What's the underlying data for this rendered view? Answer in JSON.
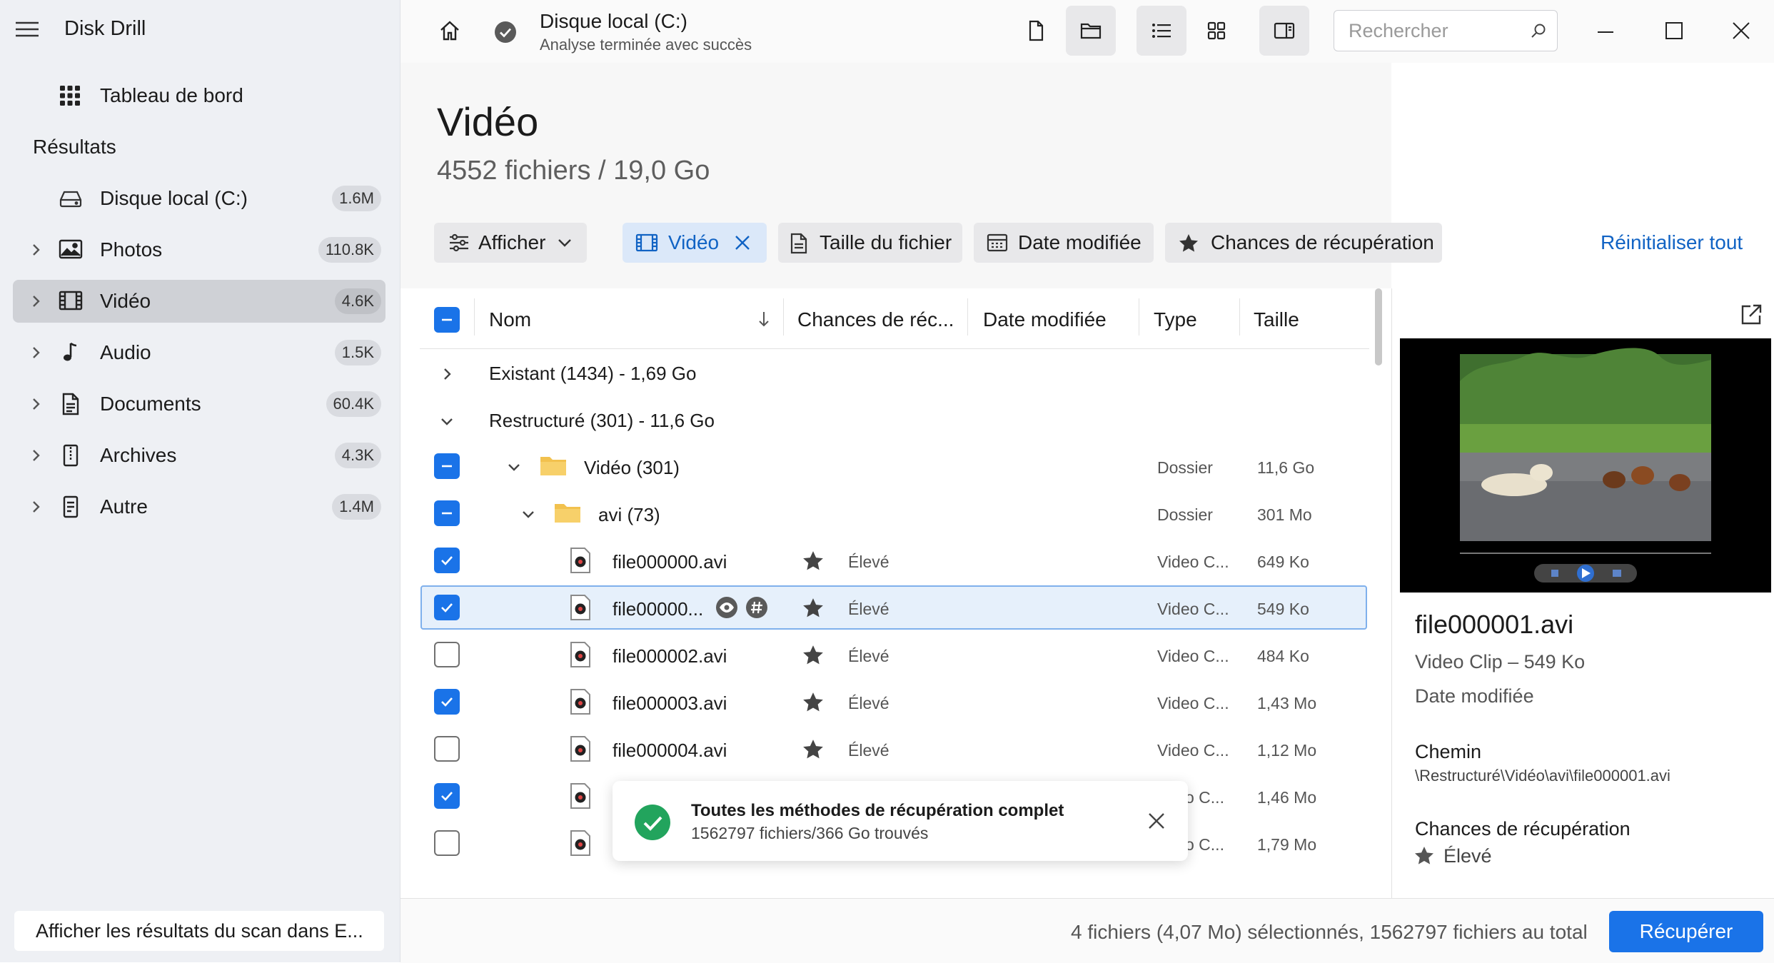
{
  "app": {
    "title": "Disk Drill"
  },
  "sidebar": {
    "dashboard_label": "Tableau de bord",
    "results_heading": "Résultats",
    "items": [
      {
        "label": "Disque local (C:)",
        "count": "1.6M"
      },
      {
        "label": "Photos",
        "count": "110.8K"
      },
      {
        "label": "Vidéo",
        "count": "4.6K"
      },
      {
        "label": "Audio",
        "count": "1.5K"
      },
      {
        "label": "Documents",
        "count": "60.4K"
      },
      {
        "label": "Archives",
        "count": "4.3K"
      },
      {
        "label": "Autre",
        "count": "1.4M"
      }
    ],
    "explorer_button": "Afficher les résultats du scan dans E..."
  },
  "header": {
    "disk_title": "Disque local (C:)",
    "disk_status": "Analyse terminée avec succès",
    "search_placeholder": "Rechercher"
  },
  "page": {
    "title": "Vidéo",
    "subtitle": "4552 fichiers / 19,0 Go"
  },
  "filters": {
    "show": "Afficher",
    "video": "Vidéo",
    "file_size": "Taille du fichier",
    "date_modified": "Date modifiée",
    "recovery_chances": "Chances de récupération",
    "reset_all": "Réinitialiser tout"
  },
  "table": {
    "columns": {
      "name": "Nom",
      "chances": "Chances de réc...",
      "date": "Date modifiée",
      "type": "Type",
      "size": "Taille"
    },
    "groups": {
      "existing": "Existant (1434) - 1,69 Go",
      "reconstructed": "Restructuré (301) - 11,6 Go"
    },
    "folders": [
      {
        "name": "Vidéo (301)",
        "type": "Dossier",
        "size": "11,6 Go"
      },
      {
        "name": "avi (73)",
        "type": "Dossier",
        "size": "301 Mo"
      }
    ],
    "rows": [
      {
        "name": "file000000.avi",
        "chance": "Élevé",
        "type": "Video C...",
        "size": "649 Ko",
        "checked": true
      },
      {
        "name": "file00000...",
        "chance": "Élevé",
        "type": "Video C...",
        "size": "549 Ko",
        "checked": true
      },
      {
        "name": "file000002.avi",
        "chance": "Élevé",
        "type": "Video C...",
        "size": "484 Ko",
        "checked": false
      },
      {
        "name": "file000003.avi",
        "chance": "Élevé",
        "type": "Video C...",
        "size": "1,43 Mo",
        "checked": true
      },
      {
        "name": "file000004.avi",
        "chance": "Élevé",
        "type": "Video C...",
        "size": "1,12 Mo",
        "checked": false
      },
      {
        "name": "",
        "chance": "",
        "type": "o C...",
        "size": "1,46 Mo",
        "checked": true
      },
      {
        "name": "",
        "chance": "",
        "type": "o C...",
        "size": "1,79 Mo",
        "checked": false
      }
    ]
  },
  "toast": {
    "title": "Toutes les méthodes de récupération complet",
    "subtitle": "1562797 fichiers/366 Go trouvés"
  },
  "preview": {
    "file_name": "file000001.avi",
    "kind": "Video Clip – 549 Ko",
    "date_label": "Date modifiée",
    "path_heading": "Chemin",
    "path": "\\Restructuré\\Vidéo\\avi\\file000001.avi",
    "chances_heading": "Chances de récupération",
    "chances_value": "Élevé"
  },
  "footer": {
    "summary": "4 fichiers (4,07 Mo) sélectionnés, 1562797 fichiers au total",
    "recover_button": "Récupérer"
  },
  "colors": {
    "accent": "#1a73e8",
    "success": "#22a45d",
    "selected_row": "#e6f0fb"
  }
}
